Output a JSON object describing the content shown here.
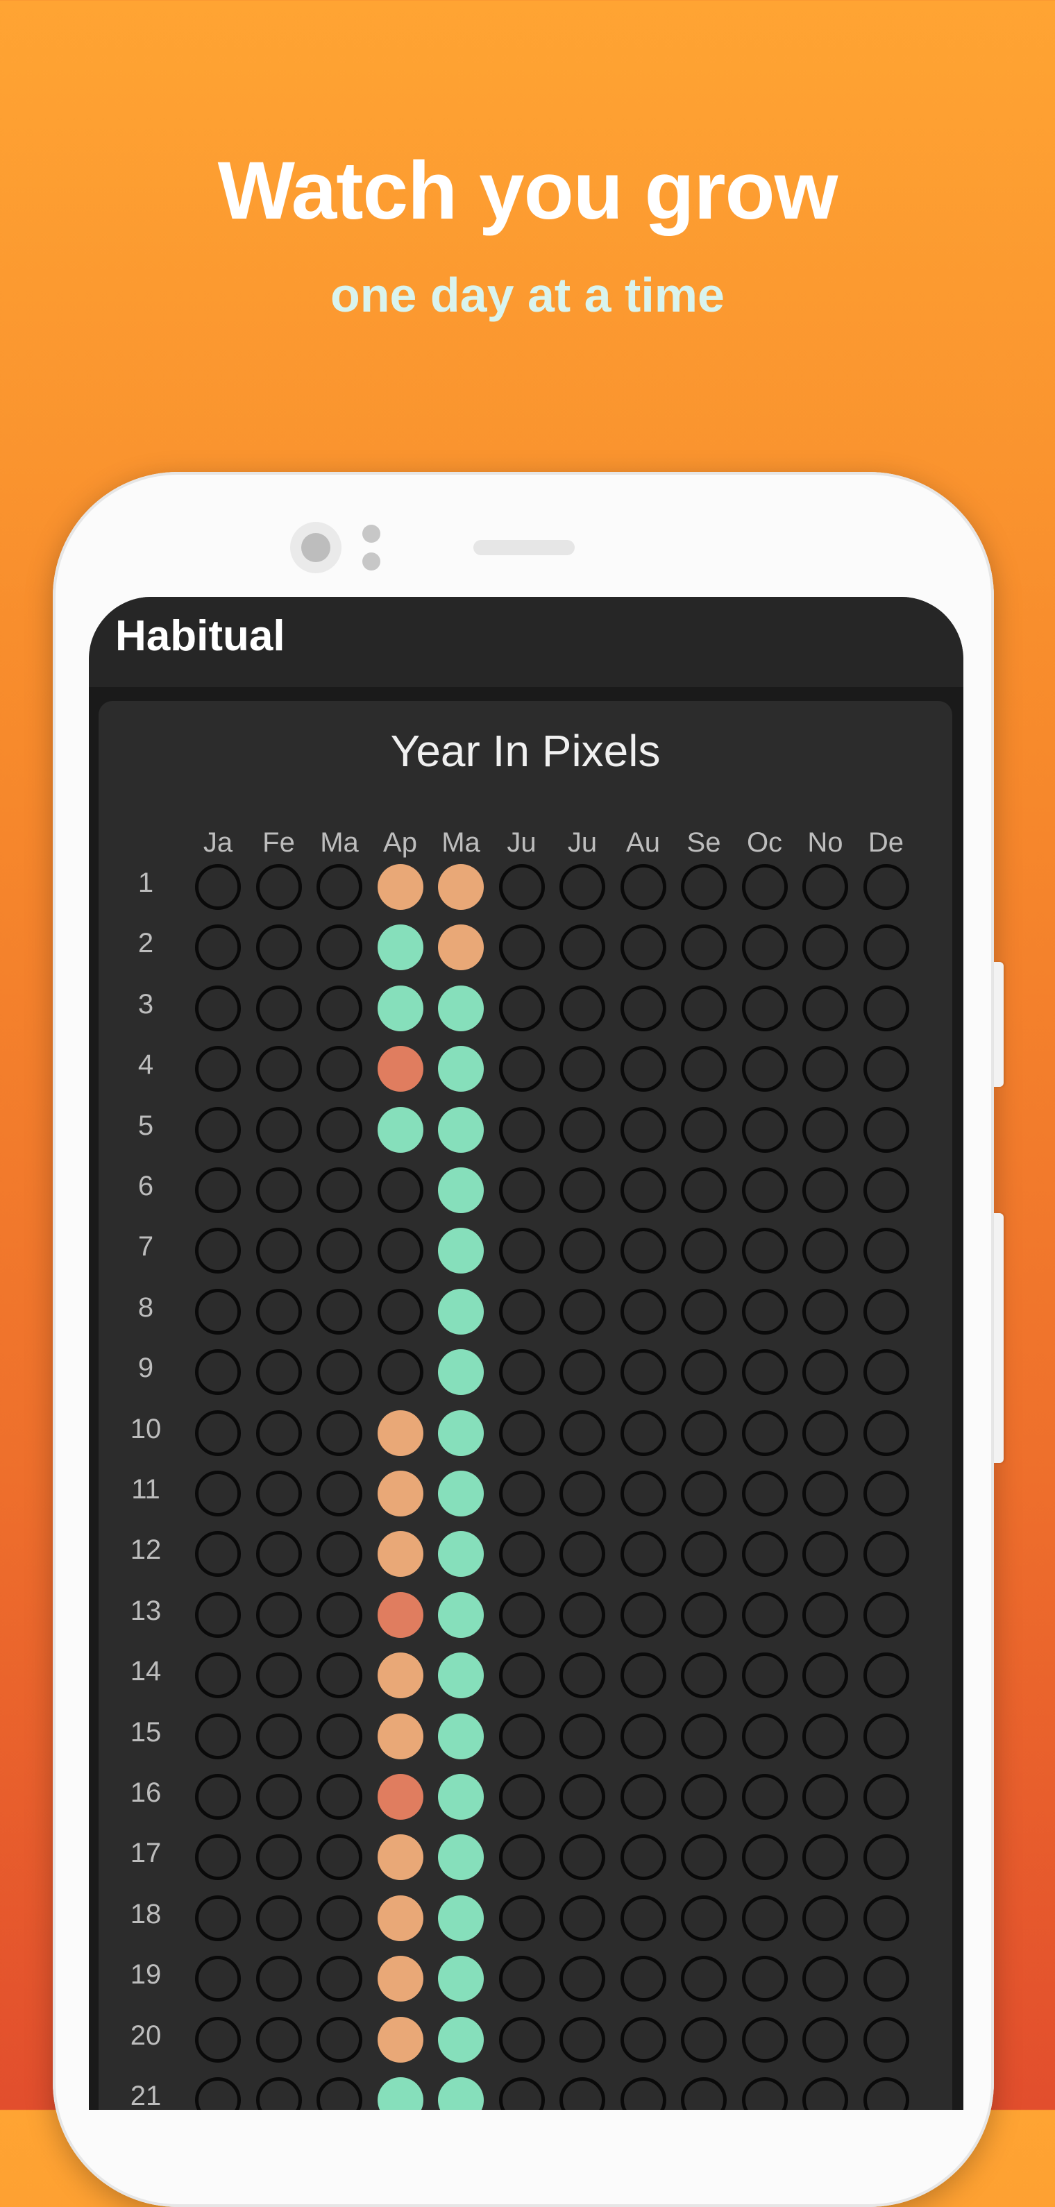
{
  "promo": {
    "headline": "Watch you grow",
    "subline": "one day at a time"
  },
  "app": {
    "title": "Habitual"
  },
  "card": {
    "title": "Year In Pixels",
    "months": [
      "Ja",
      "Fe",
      "Ma",
      "Ap",
      "Ma",
      "Ju",
      "Ju",
      "Au",
      "Se",
      "Oc",
      "No",
      "De"
    ],
    "days": [
      "1",
      "2",
      "3",
      "4",
      "5",
      "6",
      "7",
      "8",
      "9",
      "10",
      "11",
      "12",
      "13",
      "14",
      "15",
      "16",
      "17",
      "18",
      "19",
      "20",
      "21"
    ],
    "status_colors": {
      "peach": "#e9a877",
      "mint": "#86dfbb",
      "coral": "#e07d5f"
    },
    "legend_of_grid": "Each row is a day, each column a month; filled pixels carry a status color key.",
    "filled": {
      "Ap": [
        "peach",
        "mint",
        "mint",
        "coral",
        "mint",
        "",
        "",
        "",
        "",
        "peach",
        "peach",
        "peach",
        "coral",
        "peach",
        "peach",
        "coral",
        "peach",
        "peach",
        "peach",
        "peach",
        "mint"
      ],
      "Ma": [
        "peach",
        "peach",
        "mint",
        "mint",
        "mint",
        "mint",
        "mint",
        "mint",
        "mint",
        "mint",
        "mint",
        "mint",
        "mint",
        "mint",
        "mint",
        "mint",
        "mint",
        "mint",
        "mint",
        "mint",
        "mint"
      ]
    }
  }
}
